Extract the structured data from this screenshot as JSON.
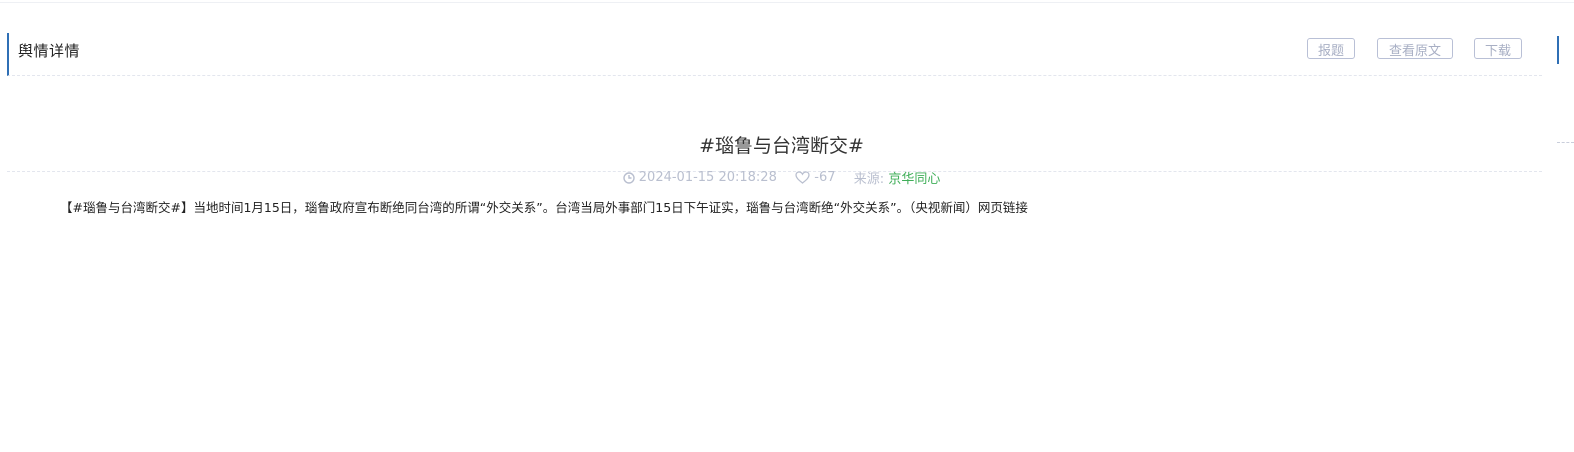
{
  "panel": {
    "title": "舆情详情",
    "buttons": {
      "report": "报题",
      "view_original": "查看原文",
      "download": "下载"
    }
  },
  "article": {
    "title": "#瑙鲁与台湾断交#",
    "datetime": "2024-01-15 20:18:28",
    "likes": "-67",
    "source_label": "来源:",
    "source_value": "京华同心",
    "content": "【#瑙鲁与台湾断交#】当地时间1月15日，瑙鲁政府宣布断绝同台湾的所谓“外交关系”。台湾当局外事部门15日下午证实，瑙鲁与台湾断绝“外交关系”。（央视新闻）网页链接"
  },
  "icons": {
    "time": "clock-icon",
    "likes": "heart-icon"
  },
  "colors": {
    "accent": "#2f6fb5",
    "source": "#3fae58",
    "muted": "#b9bfcf"
  }
}
